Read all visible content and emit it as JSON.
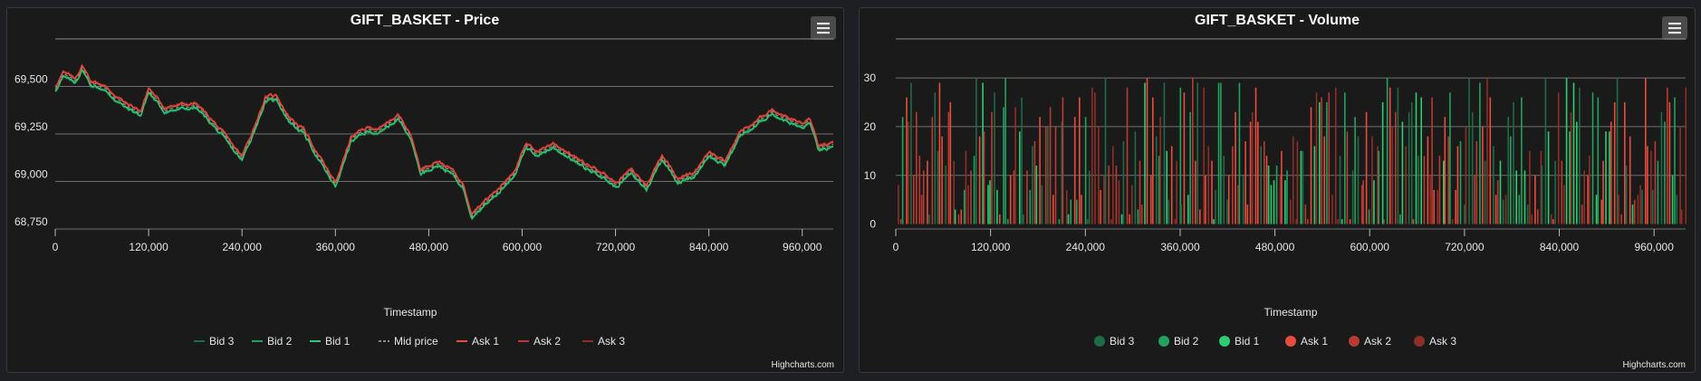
{
  "charts": [
    {
      "title": "GIFT_BASKET - Price",
      "xlabel": "Timestamp",
      "credit": "Highcharts.com",
      "legend": [
        {
          "label": "Bid 3",
          "color": "#1e6b45"
        },
        {
          "label": "Bid 2",
          "color": "#22a15f"
        },
        {
          "label": "Bid 1",
          "color": "#2ecc71"
        },
        {
          "label": "Mid price",
          "color": "#8a8a8a"
        },
        {
          "label": "Ask 1",
          "color": "#e74c3c"
        },
        {
          "label": "Ask 2",
          "color": "#b83a30"
        },
        {
          "label": "Ask 3",
          "color": "#8e2f27"
        }
      ]
    },
    {
      "title": "GIFT_BASKET - Volume",
      "xlabel": "Timestamp",
      "credit": "Highcharts.com",
      "legend": [
        {
          "label": "Bid 3",
          "color": "#1e6b45"
        },
        {
          "label": "Bid 2",
          "color": "#22a15f"
        },
        {
          "label": "Bid 1",
          "color": "#2ecc71"
        },
        {
          "label": "Ask 1",
          "color": "#e74c3c"
        },
        {
          "label": "Ask 2",
          "color": "#b83a30"
        },
        {
          "label": "Ask 3",
          "color": "#8e2f27"
        }
      ]
    }
  ],
  "chart_data": [
    {
      "type": "line",
      "title": "GIFT_BASKET - Price",
      "xlabel": "Timestamp",
      "ylabel": "",
      "xlim": [
        0,
        999900
      ],
      "ylim": [
        68750,
        69500
      ],
      "x_ticks": [
        "0",
        "120,000",
        "240,000",
        "360,000",
        "480,000",
        "600,000",
        "720,000",
        "840,000",
        "960,000"
      ],
      "y_ticks": [
        "68,750",
        "69,000",
        "69,250",
        "69,500"
      ],
      "grid": true,
      "legend_position": "bottom",
      "series_names": [
        "Bid 3",
        "Bid 2",
        "Bid 1",
        "Mid price",
        "Ask 1",
        "Ask 2",
        "Ask 3"
      ],
      "mid_price_keypoints": {
        "x": [
          0,
          10000,
          25000,
          35000,
          45000,
          60000,
          75000,
          90000,
          110000,
          120000,
          140000,
          160000,
          180000,
          200000,
          220000,
          240000,
          255000,
          270000,
          285000,
          300000,
          320000,
          345000,
          360000,
          380000,
          400000,
          420000,
          440000,
          455000,
          470000,
          490000,
          510000,
          525000,
          535000,
          550000,
          570000,
          590000,
          605000,
          620000,
          640000,
          660000,
          680000,
          700000,
          720000,
          740000,
          760000,
          780000,
          800000,
          820000,
          840000,
          860000,
          880000,
          900000,
          920000,
          940000,
          960000,
          970000,
          980000,
          999900
        ],
        "y": [
          69490,
          69560,
          69530,
          69600,
          69520,
          69500,
          69450,
          69400,
          69360,
          69480,
          69380,
          69390,
          69400,
          69320,
          69220,
          69120,
          69270,
          69430,
          69440,
          69330,
          69260,
          69080,
          68980,
          69220,
          69270,
          69270,
          69340,
          69260,
          69050,
          69100,
          69050,
          68970,
          68830,
          68880,
          68950,
          69050,
          69180,
          69150,
          69190,
          69140,
          69080,
          69050,
          68980,
          69050,
          68970,
          69130,
          69010,
          69030,
          69150,
          69090,
          69250,
          69300,
          69370,
          69330,
          69290,
          69320,
          69180,
          69180
        ]
      },
      "bid_offset": -10,
      "ask_offset": 10
    },
    {
      "type": "bar",
      "title": "GIFT_BASKET - Volume",
      "xlabel": "Timestamp",
      "ylabel": "",
      "xlim": [
        0,
        999900
      ],
      "ylim": [
        0,
        30
      ],
      "x_ticks": [
        "0",
        "120,000",
        "240,000",
        "360,000",
        "480,000",
        "600,000",
        "720,000",
        "840,000",
        "960,000"
      ],
      "y_ticks": [
        "0",
        "10",
        "20",
        "30"
      ],
      "grid": true,
      "legend_position": "bottom",
      "series_names": [
        "Bid 3",
        "Bid 2",
        "Bid 1",
        "Ask 1",
        "Ask 2",
        "Ask 3"
      ],
      "volume_range": [
        1,
        30
      ]
    }
  ]
}
